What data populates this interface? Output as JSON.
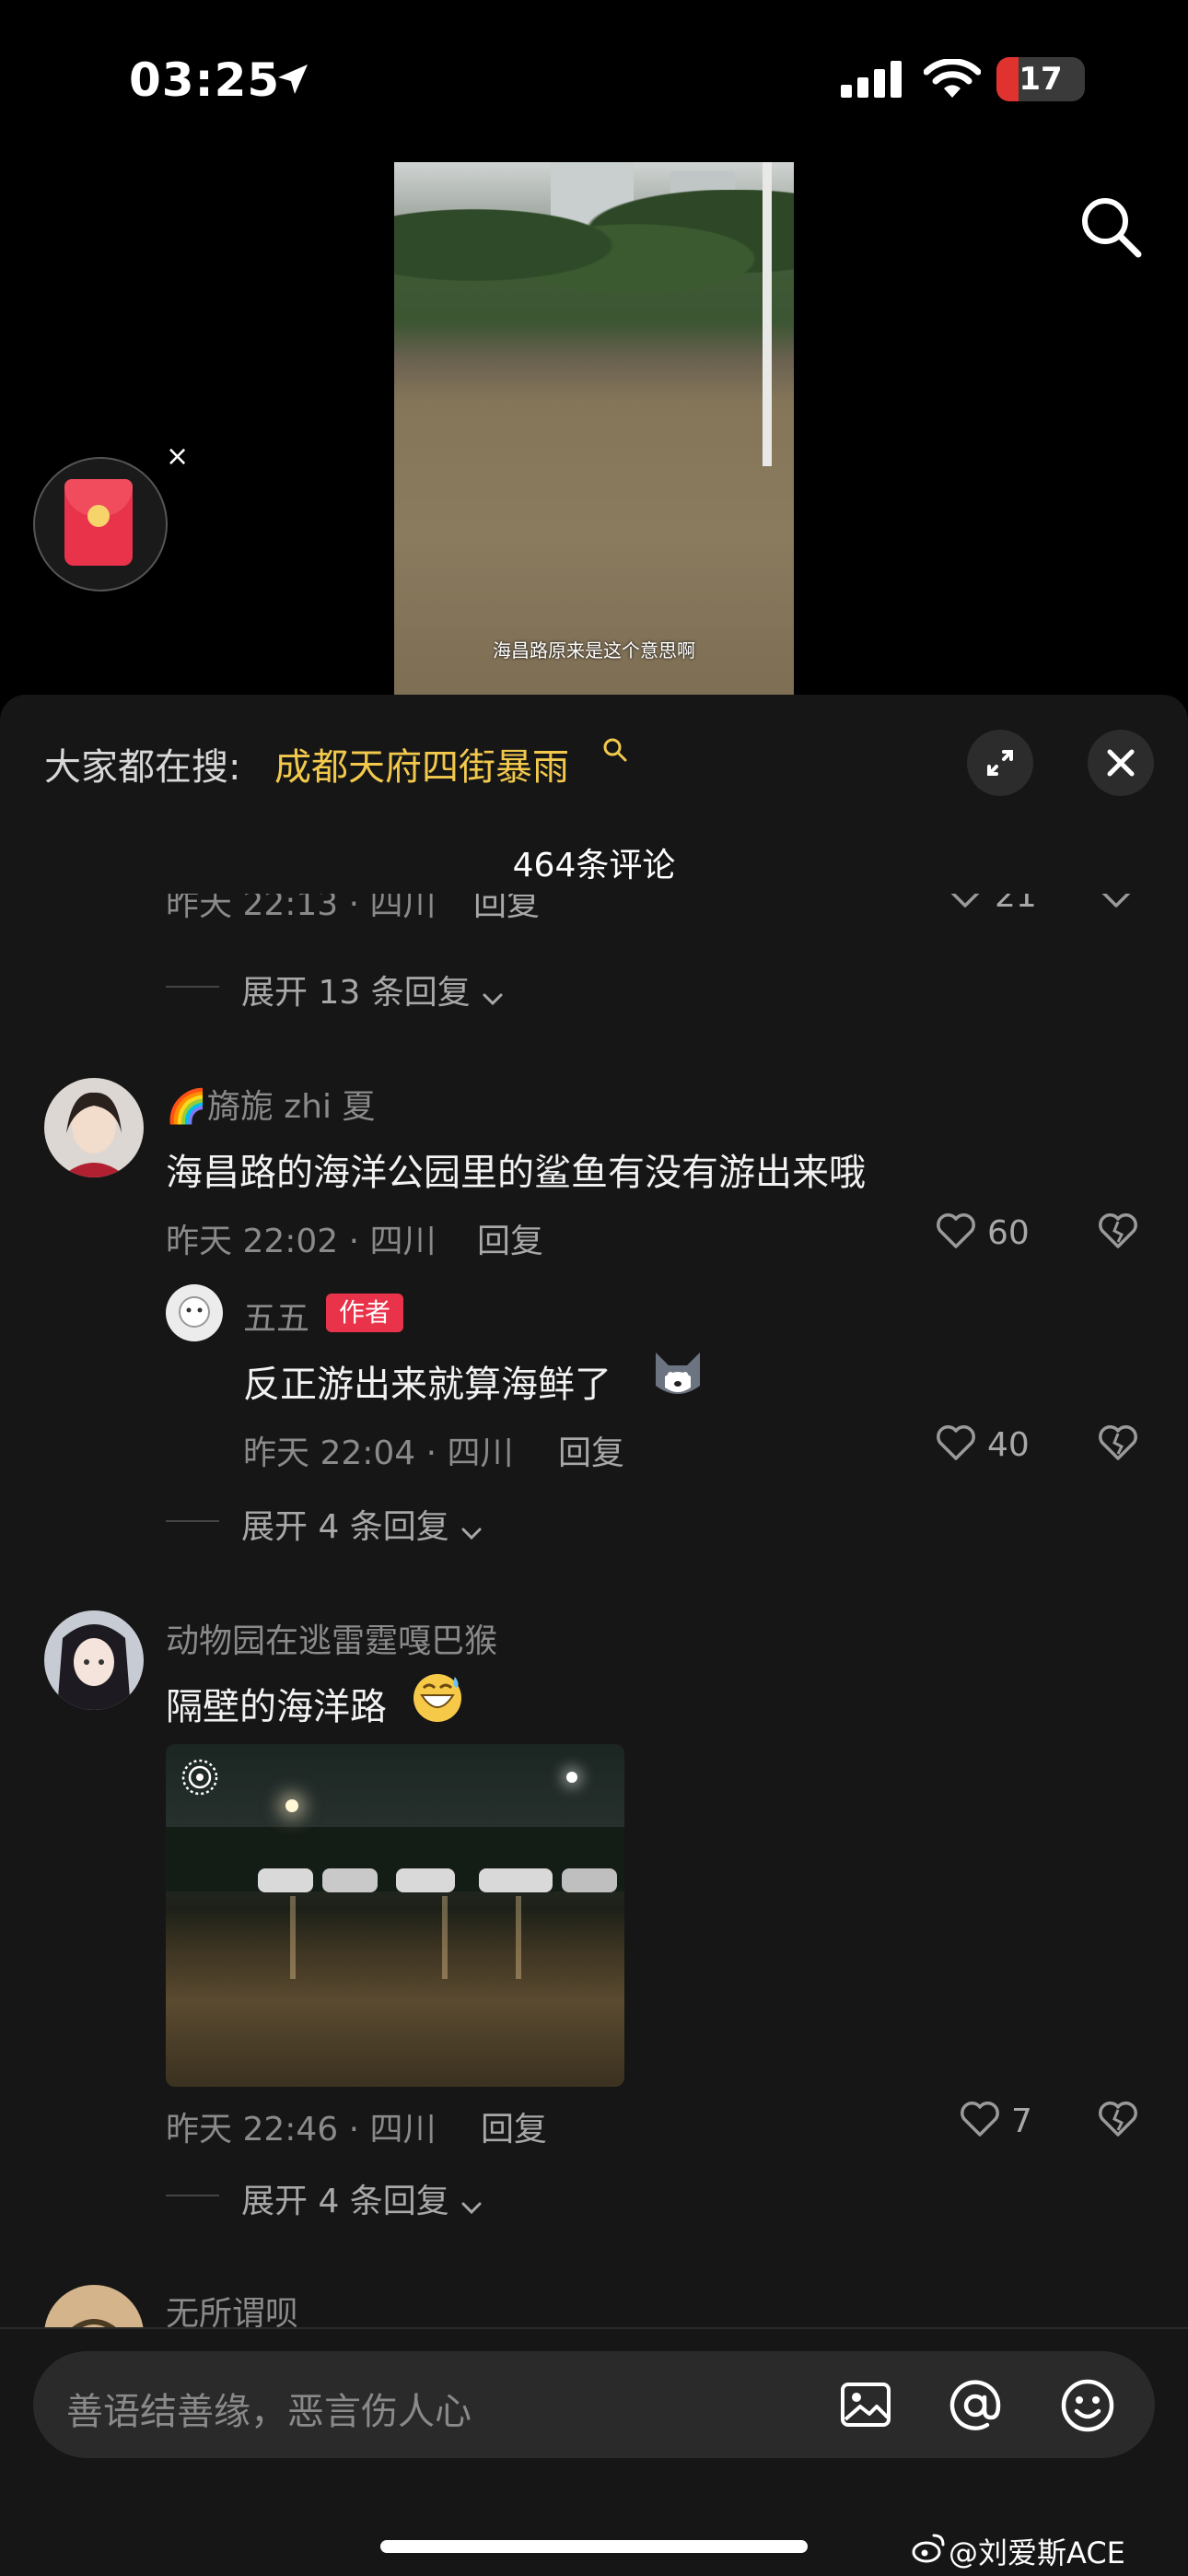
{
  "status_bar": {
    "time": "03:25",
    "battery": "17"
  },
  "video": {
    "caption": "海昌路原来是这个意思啊"
  },
  "red_packet": {
    "close": "×"
  },
  "panel": {
    "trend_prefix": "大家都在搜:",
    "trend_term": "成都天府四街暴雨",
    "comment_count": "464条评论",
    "cut_row_meta": "昨天 22:13 · 四川",
    "cut_row_reply": "回复",
    "cut_row_like": "21"
  },
  "threads": [
    {
      "expand": "展开 13 条回复"
    },
    {
      "name": "🌈旖旎 zhi 夏",
      "content": "海昌路的海洋公园里的鲨鱼有没有游出来哦",
      "time": "昨天 22:02 · 四川",
      "reply": "回复",
      "likes": "60",
      "sub": {
        "name": "五五",
        "badge": "作者",
        "content": "反正游出来就算海鲜了",
        "time": "昨天 22:04 · 四川",
        "reply": "回复",
        "likes": "40"
      },
      "expand": "展开 4 条回复"
    },
    {
      "name": "动物园在逃雷霆嘎巴猴",
      "content": "隔壁的海洋路",
      "time": "昨天 22:46 · 四川",
      "reply": "回复",
      "likes": "7",
      "expand": "展开 4 条回复"
    },
    {
      "name": "无所谓呗"
    }
  ],
  "input": {
    "placeholder": "善语结善缘，恶言伤人心"
  },
  "watermark": "@刘爱斯ACE",
  "colors": {
    "accent_yellow": "#f2c94c",
    "badge_red": "#e8334a",
    "panel_bg": "#161616"
  }
}
